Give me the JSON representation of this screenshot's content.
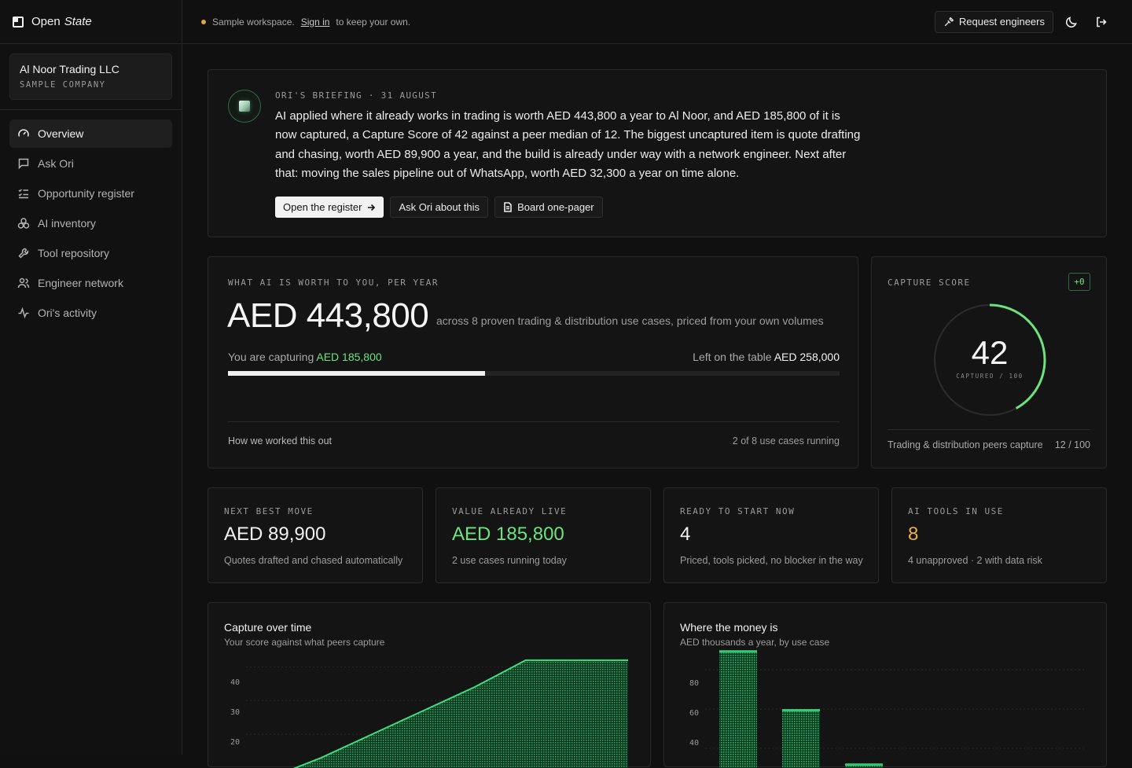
{
  "app": {
    "brand_word1": "Open",
    "brand_word2": "State"
  },
  "sidebar": {
    "company": {
      "name": "Al Noor Trading LLC",
      "tag": "SAMPLE COMPANY"
    },
    "items": [
      {
        "label": "Overview",
        "icon": "gauge-icon",
        "active": true
      },
      {
        "label": "Ask Ori",
        "icon": "chat-icon",
        "active": false
      },
      {
        "label": "Opportunity register",
        "icon": "checklist-icon",
        "active": false
      },
      {
        "label": "AI inventory",
        "icon": "boxes-icon",
        "active": false
      },
      {
        "label": "Tool repository",
        "icon": "wrench-icon",
        "active": false
      },
      {
        "label": "Engineer network",
        "icon": "people-icon",
        "active": false
      },
      {
        "label": "Ori's activity",
        "icon": "activity-icon",
        "active": false
      }
    ]
  },
  "topbar": {
    "notice_before": "Sample workspace.",
    "notice_link": "Sign in",
    "notice_after": "to keep your own.",
    "request_label": "Request engineers"
  },
  "briefing": {
    "label": "ORI'S BRIEFING · 31 AUGUST",
    "text": "AI applied where it already works in trading is worth AED 443,800 a year to Al Noor, and AED 185,800 of it is now captured, a Capture Score of 42 against a peer median of 12. The biggest uncaptured item is quote drafting and chasing, worth AED 89,900 a year, and the build is already under way with a network engineer. Next after that: moving the sales pipeline out of WhatsApp, worth AED 32,300 a year on time alone.",
    "btn_register": "Open the register",
    "btn_ask": "Ask Ori about this",
    "btn_board": "Board one-pager"
  },
  "value": {
    "kicker": "WHAT AI IS WORTH TO YOU, PER YEAR",
    "amount": "AED 443,800",
    "desc": "across 8 proven trading & distribution use cases, priced from your own volumes",
    "capturing_label": "You are capturing",
    "capturing_value": "AED 185,800",
    "left_label": "Left on the table",
    "left_value": "AED 258,000",
    "captured_fraction": 0.42,
    "how_link": "How we worked this out",
    "running": "2 of 8 use cases running"
  },
  "score": {
    "kicker": "CAPTURE SCORE",
    "delta": "+0",
    "value": "42",
    "max": 100,
    "sub": "CAPTURED / 100",
    "peer_label": "Trading & distribution peers capture",
    "peer_value": "12 / 100"
  },
  "stats": [
    {
      "kicker": "NEXT BEST MOVE",
      "value": "AED 89,900",
      "sub": "Quotes drafted and chased automatically",
      "tone": "white"
    },
    {
      "kicker": "VALUE ALREADY LIVE",
      "value": "AED 185,800",
      "sub": "2 use cases running today",
      "tone": "green"
    },
    {
      "kicker": "READY TO START NOW",
      "value": "4",
      "sub": "Priced, tools picked, no blocker in the way",
      "tone": "white"
    },
    {
      "kicker": "AI TOOLS IN USE",
      "value": "8",
      "sub": "4 unapproved · 2 with data risk",
      "tone": "yellow"
    }
  ],
  "capture_chart": {
    "title": "Capture over time",
    "subtitle": "Your score against what peers capture",
    "ticks": [
      "40",
      "30",
      "20"
    ]
  },
  "money_chart": {
    "title": "Where the money is",
    "subtitle": "AED thousands a year, by use case",
    "ticks": [
      "80",
      "60",
      "40"
    ]
  },
  "chart_data": [
    {
      "type": "area",
      "title": "Capture over time",
      "subtitle": "Your score against what peers capture",
      "ylim": [
        10,
        45
      ],
      "y_ticks": [
        20,
        30,
        40
      ],
      "series": [
        {
          "values": [
            7,
            13,
            20,
            27,
            34,
            42,
            42,
            42
          ]
        }
      ],
      "grid": true
    },
    {
      "type": "bar",
      "title": "Where the money is",
      "subtitle": "AED thousands a year, by use case",
      "ylim": [
        30,
        90
      ],
      "y_ticks": [
        40,
        60,
        80
      ],
      "values": [
        89.9,
        60,
        32.3
      ],
      "grid": true
    }
  ],
  "colors": {
    "accent_green": "#6de37f",
    "warning": "#e3a33b",
    "yellow": "#e8b04a"
  }
}
